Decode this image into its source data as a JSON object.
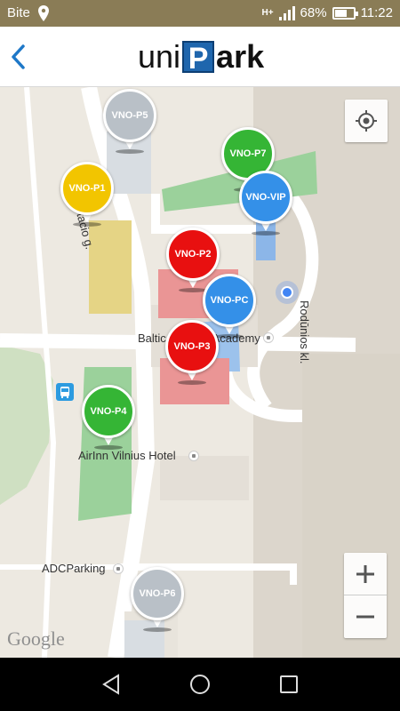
{
  "status_bar": {
    "carrier": "Bite",
    "network": "H+",
    "battery": "68%",
    "battery_level": 0.68,
    "time": "11:22"
  },
  "header": {
    "logo_uni": "uni",
    "logo_p": "P",
    "logo_ark": "ark"
  },
  "map": {
    "street_labels": {
      "street_1": "Eustacio g.",
      "street_2": "Rodūnios kl."
    },
    "places": {
      "baltic_academy": "Baltic Aviation Academy",
      "airinn_hotel": "AirInn Vilnius Hotel",
      "adc_parking": "ADCParking"
    },
    "attribution": "Google",
    "parking_pins": [
      {
        "id": "p5",
        "label": "VNO-P5",
        "color": "#b9c0c7"
      },
      {
        "id": "p7",
        "label": "VNO-P7",
        "color": "#35b535"
      },
      {
        "id": "p1",
        "label": "VNO-P1",
        "color": "#f2c500"
      },
      {
        "id": "vip",
        "label": "VNO-VIP",
        "color": "#3490e8"
      },
      {
        "id": "p2",
        "label": "VNO-P2",
        "color": "#e81010"
      },
      {
        "id": "pc",
        "label": "VNO-PC",
        "color": "#3490e8"
      },
      {
        "id": "p3",
        "label": "VNO-P3",
        "color": "#e81010"
      },
      {
        "id": "p4",
        "label": "VNO-P4",
        "color": "#35b535"
      },
      {
        "id": "p6",
        "label": "VNO-P6",
        "color": "#b9c0c7"
      }
    ]
  }
}
